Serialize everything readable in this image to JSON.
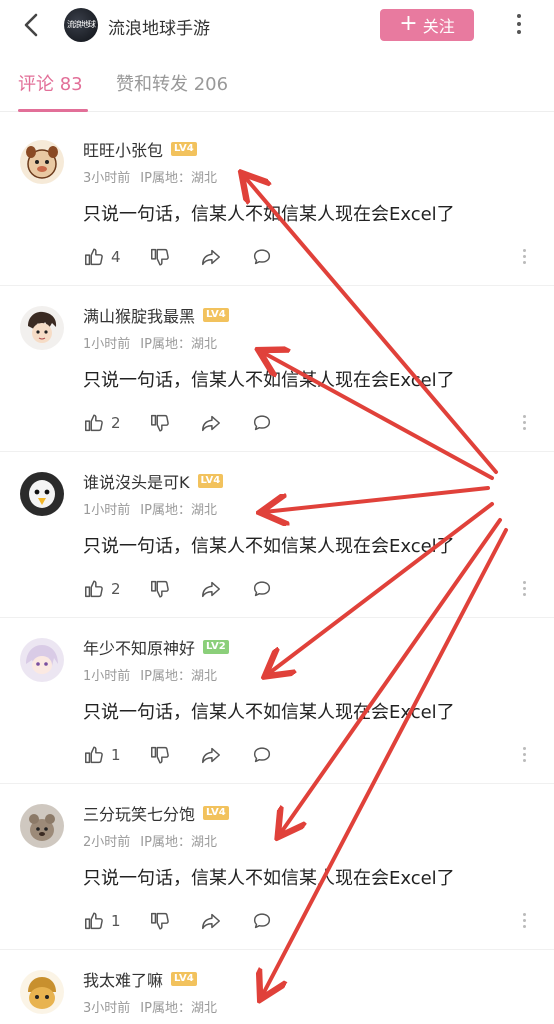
{
  "header": {
    "logo_text": "流浪地球",
    "title": "流浪地球手游",
    "follow_label": "关注"
  },
  "tabs": [
    {
      "label": "评论 83"
    },
    {
      "label": "赞和转发 206"
    }
  ],
  "comments": [
    {
      "user": "旺旺小张包",
      "level": "LV4",
      "time": "3小时前",
      "ip": "IP属地：湖北",
      "text": "只说一句话，信某人不如信某人现在会Excel了",
      "likes": "4"
    },
    {
      "user": "满山猴腚我最黑",
      "level": "LV4",
      "time": "1小时前",
      "ip": "IP属地：湖北",
      "text": "只说一句话，信某人不如信某人现在会Excel了",
      "likes": "2"
    },
    {
      "user": "谁说沒头是可K",
      "level": "LV4",
      "time": "1小时前",
      "ip": "IP属地：湖北",
      "text": "只说一句话，信某人不如信某人现在会Excel了",
      "likes": "2"
    },
    {
      "user": "年少不知原神好",
      "level": "LV2",
      "time": "1小时前",
      "ip": "IP属地：湖北",
      "text": "只说一句话，信某人不如信某人现在会Excel了",
      "likes": "1"
    },
    {
      "user": "三分玩笑七分饱",
      "level": "LV4",
      "time": "2小时前",
      "ip": "IP属地：湖北",
      "text": "只说一句话，信某人不如信某人现在会Excel了",
      "likes": "1"
    },
    {
      "user": "我太难了嘛",
      "level": "LV4",
      "time": "3小时前",
      "ip": "IP属地：湖北",
      "text": "",
      "likes": ""
    }
  ],
  "colors": {
    "accent": "#e26f98",
    "follow_button": "#e87a9f",
    "annotation_arrow": "#e0413a"
  },
  "icons": [
    "back-arrow-icon",
    "more-vertical-icon",
    "thumb-up-icon",
    "thumb-down-icon",
    "share-icon",
    "reply-icon",
    "more-dots-icon"
  ]
}
